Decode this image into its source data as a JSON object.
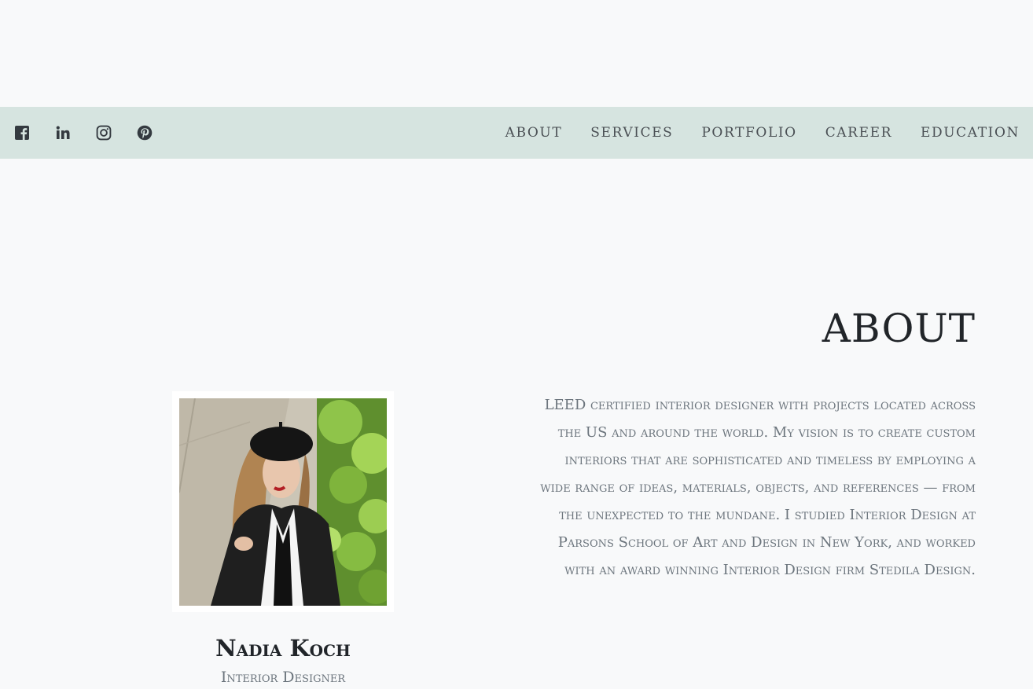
{
  "social": {
    "facebook": "facebook-icon",
    "linkedin": "linkedin-icon",
    "instagram": "instagram-icon",
    "pinterest": "pinterest-icon"
  },
  "nav": {
    "items": [
      "About",
      "Services",
      "Portfolio",
      "Career",
      "Education"
    ]
  },
  "about": {
    "title": "ABOUT",
    "name": "Nadia Koch",
    "role": "Interior Designer",
    "bio": "LEED certified interior designer with projects located across the US and around the world. My vision is to create custom interiors that are sophisticated and timeless by employing a wide range of ideas, materials, objects, and references — from the unexpected to the mundane. I studied Interior Design at Parsons School of Art and Design in New York, and worked with an award winning Interior Design firm Stedila Design."
  },
  "colors": {
    "background": "#f8f9fa",
    "navbar": "#d6e4e0",
    "heading": "#212529",
    "muted": "#6c757d"
  }
}
